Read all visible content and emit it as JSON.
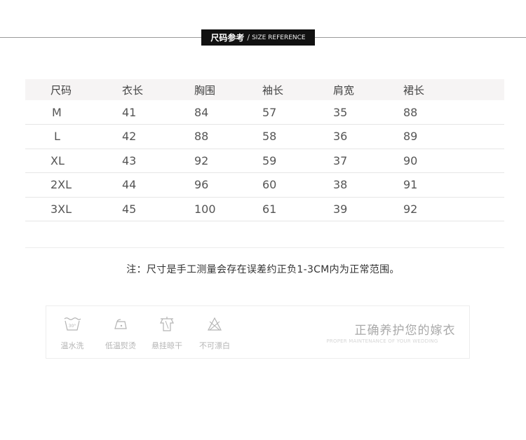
{
  "banner": {
    "title_zh": "尺码参考",
    "separator": "/",
    "title_en": "SIZE REFERENCE"
  },
  "size_table": {
    "headers": [
      "尺码",
      "衣长",
      "胸围",
      "袖长",
      "肩宽",
      "裙长"
    ],
    "rows": [
      [
        "M",
        "41",
        "84",
        "57",
        "35",
        "88"
      ],
      [
        "L",
        "42",
        "88",
        "58",
        "36",
        "89"
      ],
      [
        "XL",
        "43",
        "92",
        "59",
        "37",
        "90"
      ],
      [
        "2XL",
        "44",
        "96",
        "60",
        "38",
        "91"
      ],
      [
        "3XL",
        "45",
        "100",
        "61",
        "39",
        "92"
      ]
    ]
  },
  "note": "注：尺寸是手工测量会存在误差约正负1-3CM内为正常范围。",
  "care": {
    "items": [
      {
        "icon": "warm-wash-icon",
        "label": "温水洗"
      },
      {
        "icon": "low-iron-icon",
        "label": "低温熨烫"
      },
      {
        "icon": "hang-dry-icon",
        "label": "悬挂晾干"
      },
      {
        "icon": "no-bleach-icon",
        "label": "不可漂白"
      }
    ],
    "title": "正确养护您的嫁衣",
    "subtitle": "PROPER MAINTENANCE OF YOUR WEDDING",
    "wash_temp": "30°"
  }
}
